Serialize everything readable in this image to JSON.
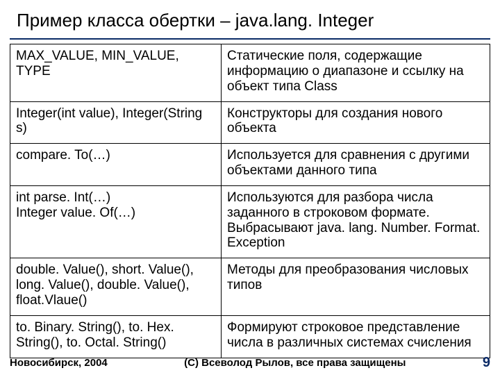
{
  "title": "Пример класса обертки – java.lang. Integer",
  "rows": [
    {
      "left": "MAX_VALUE, MIN_VALUE, TYPE",
      "right": "Статические поля, содержащие информацию о диапазоне и ссылку на объект типа Class"
    },
    {
      "left": "Integer(int value), Integer(String s)",
      "right": "Конструкторы для создания нового объекта"
    },
    {
      "left": "compare. To(…)",
      "right": "Используется для сравнения с другими объектами данного типа"
    },
    {
      "left": "int parse. Int(…)\nInteger value. Of(…)",
      "right": "Используются для разбора числа заданного в строковом формате. Выбрасывают java. lang. Number. Format. Exception"
    },
    {
      "left": "double. Value(), short. Value(), long. Value(), double. Value(), float.Vlaue()",
      "right": "Методы для преобразования числовых типов"
    },
    {
      "left": "to. Binary. String(), to. Hex. String(), to. Octal. String()",
      "right": "Формируют строковое представление числа в различных системах счисления"
    }
  ],
  "footer": {
    "location": "Новосибирск, 2004",
    "copyright": "(С) Всеволод Рылов, все права защищены",
    "page": "9"
  }
}
